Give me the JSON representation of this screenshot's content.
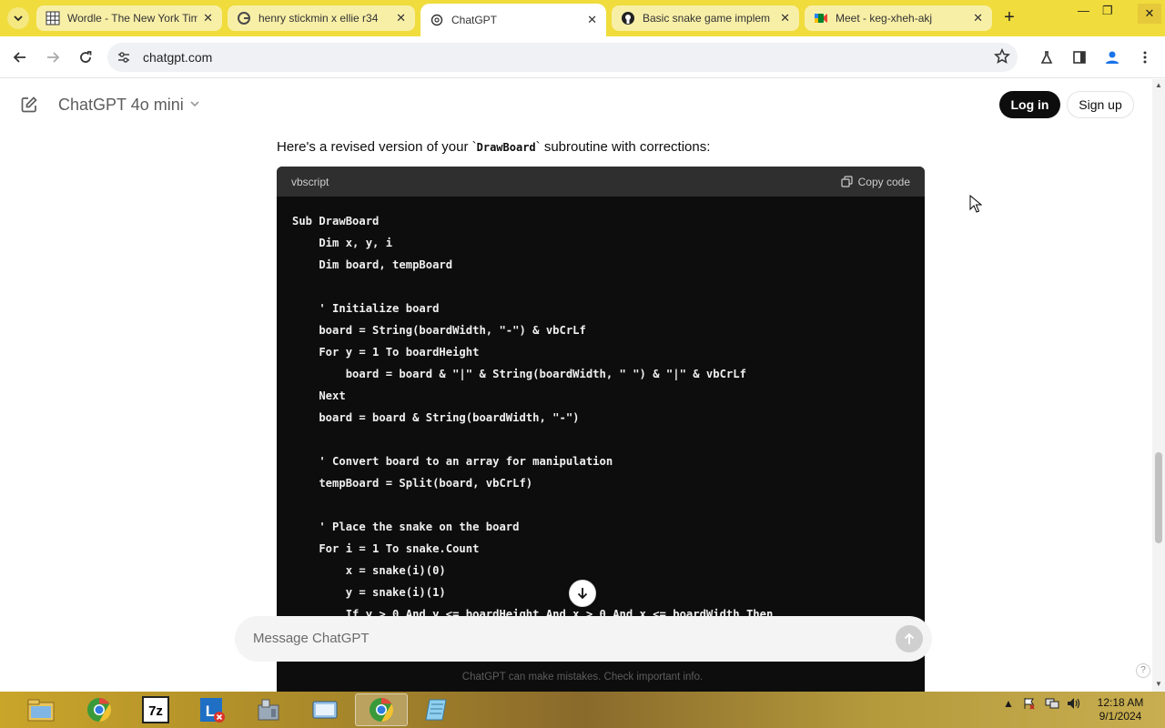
{
  "browser": {
    "tabs": [
      {
        "title": "Wordle - The New York Times",
        "icon": "wordle-grid-icon",
        "active": false
      },
      {
        "title": "henry stickmin x ellie r34",
        "icon": "google-icon",
        "active": false
      },
      {
        "title": "ChatGPT",
        "icon": "chatgpt-icon",
        "active": true
      },
      {
        "title": "Basic snake game implem",
        "icon": "github-icon",
        "active": false
      },
      {
        "title": "Meet - keg-xheh-akj",
        "icon": "meet-icon",
        "active": false
      }
    ],
    "url": "chatgpt.com"
  },
  "header": {
    "model_label": "ChatGPT 4o mini",
    "login_label": "Log in",
    "signup_label": "Sign up"
  },
  "message": {
    "intro_before": "Here's a revised version of your `",
    "intro_code": "DrawBoard",
    "intro_after": "` subroutine with corrections:",
    "code_language": "vbscript",
    "copy_label": "Copy code",
    "code_lines": [
      "Sub DrawBoard",
      "    Dim x, y, i",
      "    Dim board, tempBoard",
      "",
      "    ' Initialize board",
      "    board = String(boardWidth, \"-\") & vbCrLf",
      "    For y = 1 To boardHeight",
      "        board = board & \"|\" & String(boardWidth, \" \") & \"|\" & vbCrLf",
      "    Next",
      "    board = board & String(boardWidth, \"-\")",
      "",
      "    ' Convert board to an array for manipulation",
      "    tempBoard = Split(board, vbCrLf)",
      "",
      "    ' Place the snake on the board",
      "    For i = 1 To snake.Count",
      "        x = snake(i)(0)",
      "        y = snake(i)(1)",
      "        If y > 0 And y <= boardHeight And x > 0 And x <= boardWidth Then"
    ]
  },
  "composer": {
    "placeholder": "Message ChatGPT",
    "disclaimer": "ChatGPT can make mistakes. Check important info.",
    "help": "?"
  },
  "taskbar": {
    "apps": [
      "file-explorer-icon",
      "chrome-icon",
      "7zip-icon",
      "lync-icon",
      "control-panel-icon",
      "explorer-icon",
      "chrome-icon",
      "notepad-icon"
    ],
    "time": "12:18 AM",
    "date": "9/1/2024"
  },
  "colors": {
    "tabstrip": "#f0dc3c",
    "code_bg": "#0d0d0d",
    "code_header": "#2f2f2f",
    "login_bg": "#0d0d0d"
  }
}
